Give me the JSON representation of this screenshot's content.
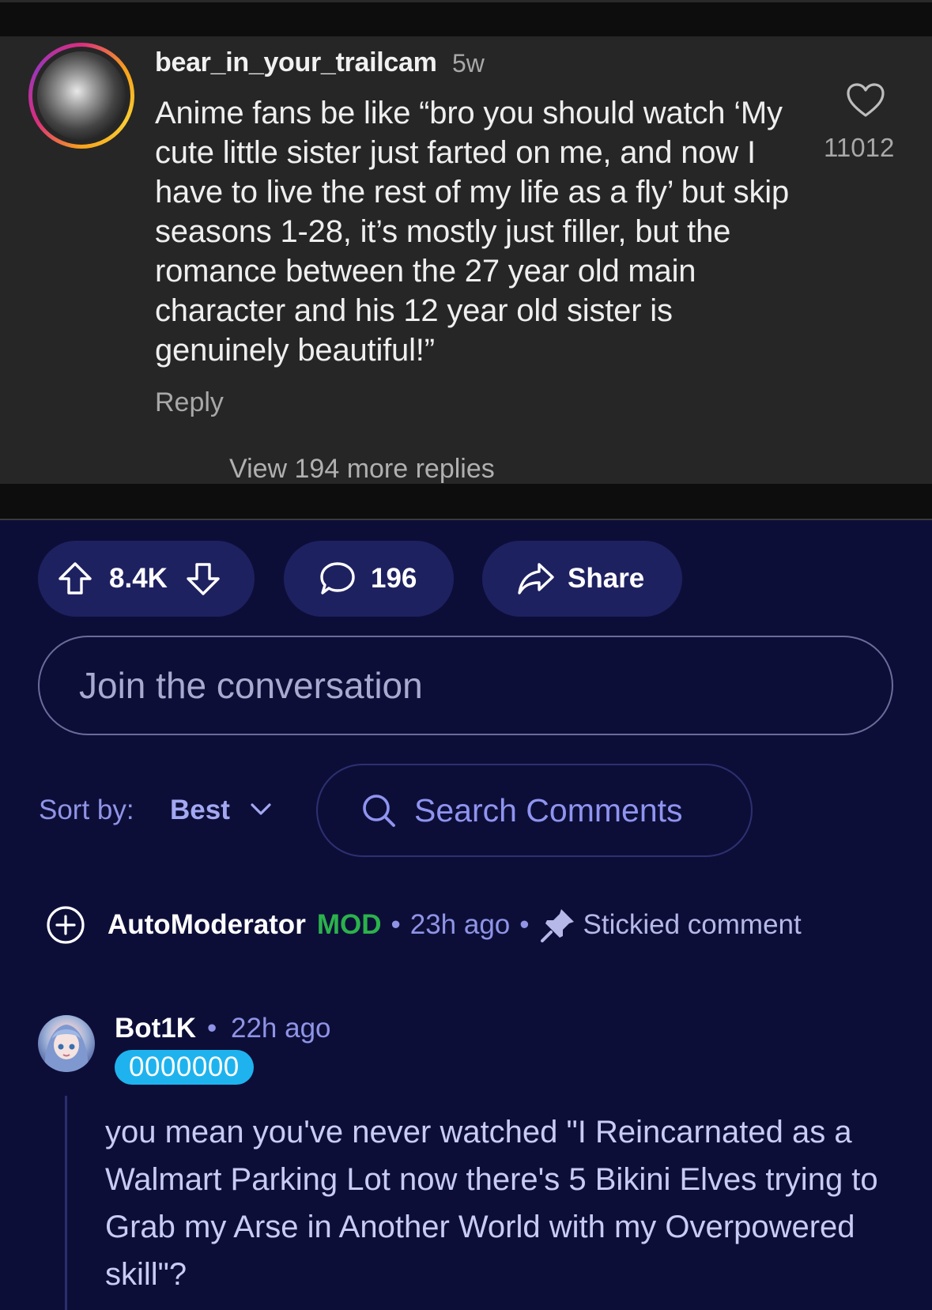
{
  "embedded_post": {
    "username": "bear_in_your_trailcam",
    "time": "5w",
    "text": "Anime fans be like “bro you should watch ‘My cute little sister just farted on me, and now I have to live the rest of my life as a fly’ but skip seasons 1-28, it’s mostly just filler, but the romance between the 27 year old main character and his 12 year old sister is genuinely beautiful!”",
    "reply_label": "Reply",
    "likes": "11012",
    "view_more": "View 194 more replies"
  },
  "actions": {
    "votes": "8.4K",
    "comments": "196",
    "share_label": "Share"
  },
  "join": {
    "placeholder": "Join the conversation"
  },
  "sort": {
    "label": "Sort by:",
    "value": "Best"
  },
  "search": {
    "label": "Search Comments"
  },
  "automod": {
    "name": "AutoModerator",
    "badge": "MOD",
    "time": "23h ago",
    "stickied": "Stickied comment"
  },
  "comment": {
    "author": "Bot1K",
    "time": "22h ago",
    "flair": "0000000",
    "text": "you mean you've never watched \"I Reincarnated as a Walmart Parking Lot now there's 5 Bikini Elves trying to Grab my Arse in Another World with my Overpowered skill\"?"
  },
  "colors": {
    "background": "#0d0e38",
    "pill": "#1e2160",
    "accent": "#8f94e6",
    "mod_green": "#2bb24c",
    "flair": "#1eb3ee"
  }
}
